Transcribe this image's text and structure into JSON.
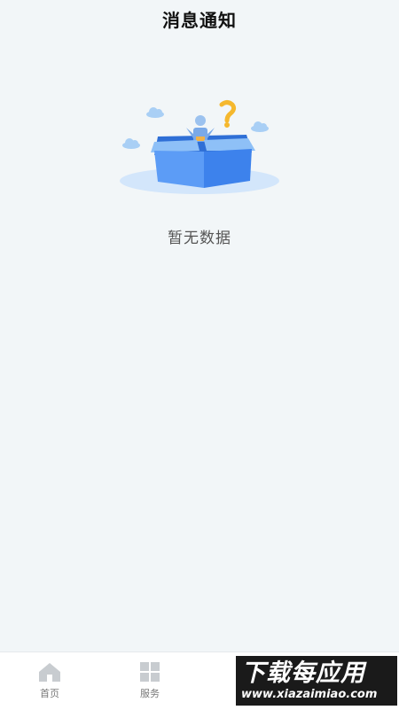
{
  "header": {
    "title": "消息通知"
  },
  "empty_state": {
    "illustration_icon": "empty-box-icon",
    "message": "暂无数据"
  },
  "tabbar": {
    "items": [
      {
        "label": "首页",
        "icon": "home-icon"
      },
      {
        "label": "服务",
        "icon": "grid-icon"
      }
    ]
  },
  "watermark": {
    "title": "下载每应用",
    "url": "www.xiazaimiao.com"
  },
  "colors": {
    "background": "#f2f6f8",
    "box_blue": "#4e8ef5",
    "question_mark": "#f5b82e",
    "tab_icon": "#c8ccd0"
  }
}
